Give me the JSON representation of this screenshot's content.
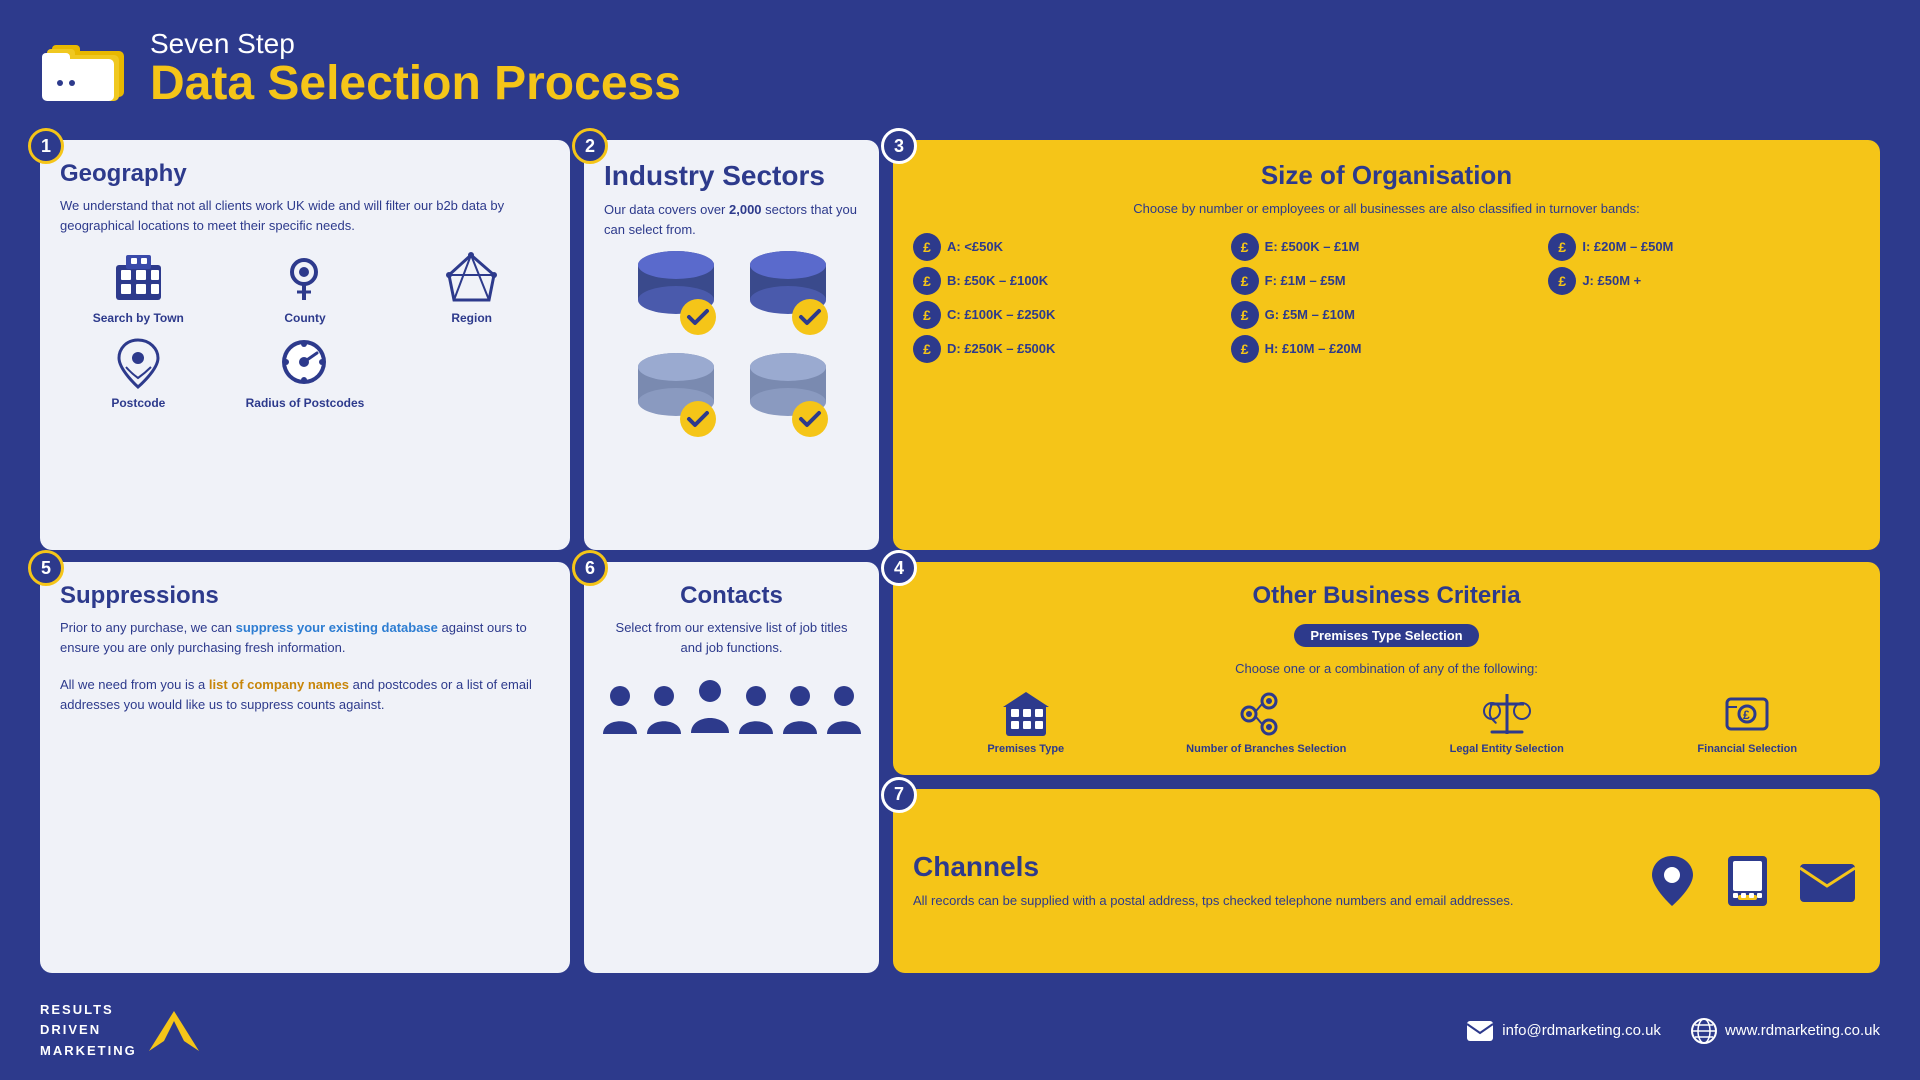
{
  "header": {
    "subtitle": "Seven Step",
    "title": "Data Selection Process",
    "icon_label": "folder-icon"
  },
  "step1": {
    "number": "1",
    "title": "Geography",
    "description": "We understand that not all clients work UK wide and will filter our b2b data by geographical locations to meet their specific needs.",
    "icons": [
      {
        "label": "Search by Town",
        "icon": "🏢"
      },
      {
        "label": "County",
        "icon": "📍"
      },
      {
        "label": "Region",
        "icon": "🗺"
      },
      {
        "label": "Postcode",
        "icon": "📌"
      },
      {
        "label": "Radius of Postcodes",
        "icon": "🎯"
      }
    ]
  },
  "step2": {
    "number": "2",
    "title": "Industry Sectors",
    "description": "Our data covers over 2,000 sectors that you can select from.",
    "highlight": "2,000"
  },
  "step3": {
    "number": "3",
    "title": "Size of Organisation",
    "description": "Choose by number or employees or all businesses are also classified in turnover bands:",
    "bands": [
      {
        "label": "A: <£50K"
      },
      {
        "label": "B: £50K – £100K"
      },
      {
        "label": "C: £100K – £250K"
      },
      {
        "label": "D: £250K – £500K"
      },
      {
        "label": "E: £500K – £1M"
      },
      {
        "label": "F: £1M – £5M"
      },
      {
        "label": "G: £5M – £10M"
      },
      {
        "label": "H: £10M – £20M"
      },
      {
        "label": "I: £20M – £50M"
      },
      {
        "label": "J: £50M +"
      }
    ]
  },
  "step4": {
    "number": "4",
    "title": "Other Business Criteria",
    "badge": "Premises Type Selection",
    "description": "Choose one or a combination of any of the following:",
    "criteria": [
      {
        "label": "Premises Type",
        "icon": "🏢"
      },
      {
        "label": "Number of Branches Selection",
        "icon": "📍"
      },
      {
        "label": "Legal Entity Selection",
        "icon": "⚖"
      },
      {
        "label": "Financial Selection",
        "icon": "💷"
      }
    ]
  },
  "step5": {
    "number": "5",
    "title": "Suppressions",
    "text1": "Prior to any purchase, we can ",
    "highlight1": "suppress your existing database",
    "text2": " against ours to ensure you are only purchasing fresh information.",
    "text3": "All we need from you is a ",
    "highlight2": "list of company names",
    "text4": " and postcodes or a list of email addresses you would like us to suppress counts against."
  },
  "step6": {
    "number": "6",
    "title": "Contacts",
    "description": "Select from our extensive list of job titles and job functions."
  },
  "step7": {
    "number": "7",
    "title": "Channels",
    "description": "All records can be supplied with a postal address, tps checked telephone numbers and email addresses."
  },
  "footer": {
    "logo_line1": "RESULTS",
    "logo_line2": "DRIVEN",
    "logo_line3": "MARKETING",
    "email": "info@rdmarketing.co.uk",
    "website": "www.rdmarketing.co.uk"
  }
}
